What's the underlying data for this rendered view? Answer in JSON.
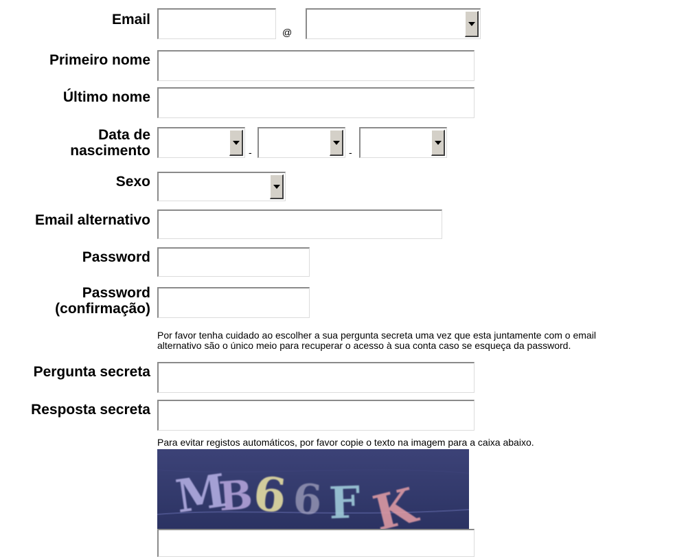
{
  "form": {
    "email": {
      "label": "Email",
      "user": "",
      "at": "@",
      "domain_selected": ""
    },
    "first_name": {
      "label": "Primeiro nome",
      "value": ""
    },
    "last_name": {
      "label": "Último nome",
      "value": ""
    },
    "birth_date": {
      "label_line1": "Data de",
      "label_line2": "nascimento",
      "day": "",
      "month": "",
      "year": "",
      "separator": "-"
    },
    "sex": {
      "label": "Sexo",
      "selected": ""
    },
    "alt_email": {
      "label": "Email alternativo",
      "value": ""
    },
    "password": {
      "label": "Password",
      "value": ""
    },
    "password_confirm": {
      "label_line1": "Password",
      "label_line2": "(confirmação)",
      "value": ""
    },
    "secret_note_line1": "Por favor tenha cuidado ao escolher a sua pergunta secreta uma vez que esta juntamente com o email",
    "secret_note_line2": "alternativo são o único meio para recuperar o acesso à sua conta caso se esqueça da password.",
    "secret_question": {
      "label": "Pergunta secreta",
      "value": ""
    },
    "secret_answer": {
      "label": "Resposta secreta",
      "value": ""
    },
    "captcha_note": "Para evitar registos automáticos, por favor copie o texto na imagem para a caixa abaixo.",
    "captcha_text": "MB66FK",
    "captcha_input": ""
  },
  "icons": {
    "dropdown": "chevron-down-icon"
  }
}
